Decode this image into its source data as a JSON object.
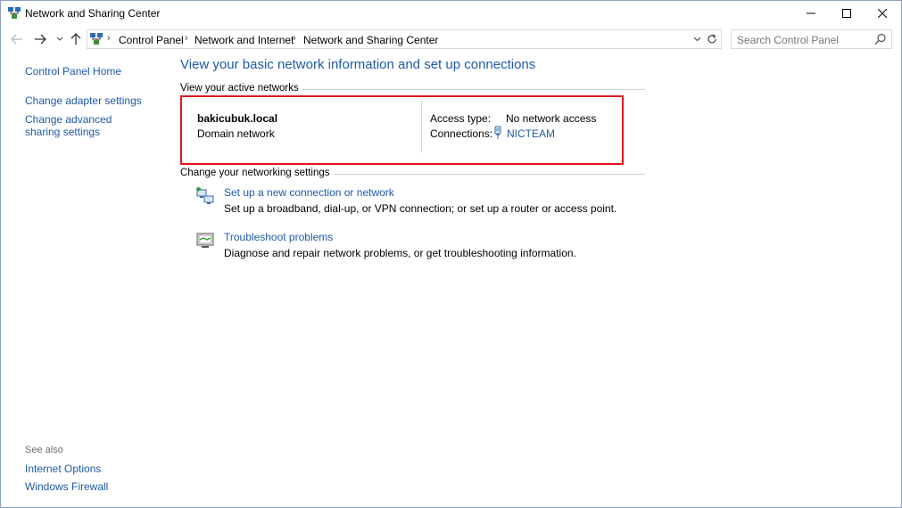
{
  "window": {
    "title": "Network and Sharing Center",
    "icons": {
      "app": "network-center-icon",
      "minimize": "minimize-icon",
      "maximize": "maximize-icon",
      "close": "close-icon"
    }
  },
  "navigation": {
    "icons": {
      "back": "arrow-left-icon",
      "forward": "arrow-right-icon",
      "recent": "chevron-down-icon",
      "up": "arrow-up-icon",
      "refresh": "refresh-icon"
    },
    "breadcrumbs": [
      "Control Panel",
      "Network and Internet",
      "Network and Sharing Center"
    ],
    "search_placeholder": "Search Control Panel"
  },
  "sidebar": {
    "home": "Control Panel Home",
    "links": [
      "Change adapter settings",
      "Change advanced sharing settings"
    ],
    "see_also_label": "See also",
    "see_also": [
      "Internet Options",
      "Windows Firewall"
    ]
  },
  "main": {
    "title": "View your basic network information and set up connections",
    "active_networks_heading": "View your active networks",
    "network": {
      "name": "bakicubuk.local",
      "category": "Domain network",
      "access_type_label": "Access type:",
      "access_type_value": "No network access",
      "connections_label": "Connections:",
      "connection_name": "NICTEAM"
    },
    "settings_heading": "Change your networking settings",
    "tasks": [
      {
        "title": "Set up a new connection or network",
        "description": "Set up a broadband, dial-up, or VPN connection; or set up a router or access point.",
        "icon": "new-connection-icon"
      },
      {
        "title": "Troubleshoot problems",
        "description": "Diagnose and repair network problems, or get troubleshooting information.",
        "icon": "troubleshoot-icon"
      }
    ]
  },
  "colors": {
    "link": "#1e5aa8",
    "highlight_border": "#e0151d"
  }
}
